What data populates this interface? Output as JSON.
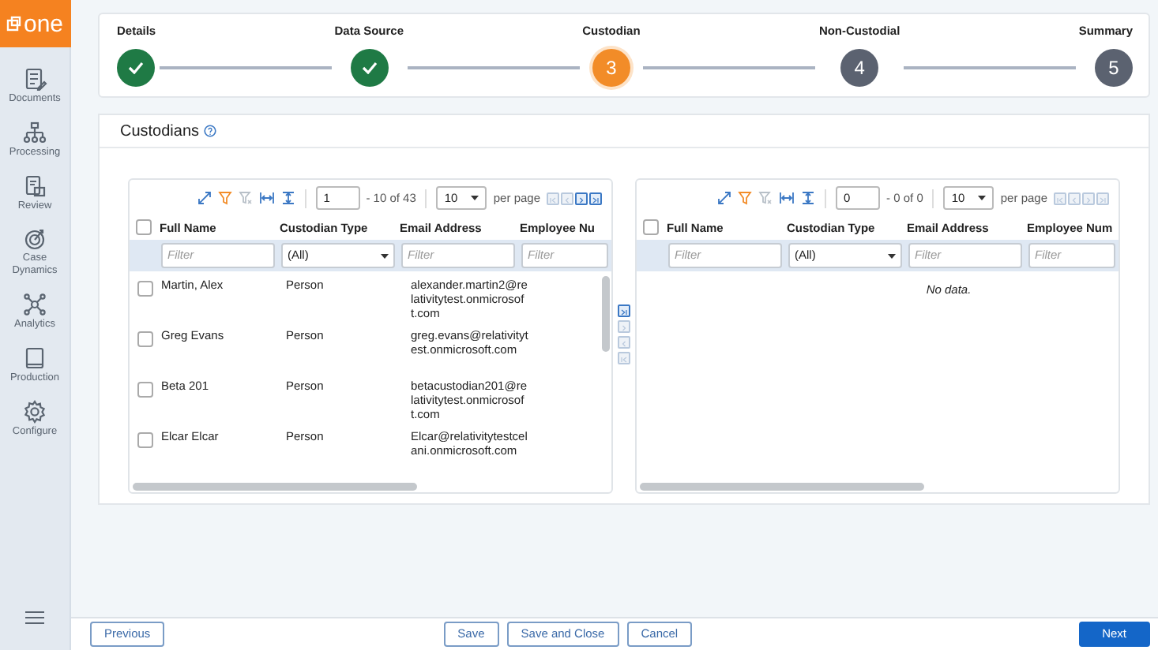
{
  "logo": {
    "text": "one"
  },
  "sidebar": {
    "items": [
      {
        "label": "Documents"
      },
      {
        "label": "Processing"
      },
      {
        "label": "Review"
      },
      {
        "label": "Case Dynamics"
      },
      {
        "label": "Analytics"
      },
      {
        "label": "Production"
      },
      {
        "label": "Configure"
      }
    ]
  },
  "stepper": {
    "steps": [
      {
        "label": "Details",
        "completed": true,
        "selected": false
      },
      {
        "label": "Data Source",
        "completed": true,
        "selected": false
      },
      {
        "label": "Custodian",
        "number": "3",
        "completed": false,
        "selected": true
      },
      {
        "label": "Non-Custodial",
        "number": "4",
        "completed": false,
        "selected": false
      },
      {
        "label": "Summary",
        "number": "5",
        "completed": false,
        "selected": false
      }
    ]
  },
  "section": {
    "title": "Custodians"
  },
  "grids": [
    {
      "all_checked": false,
      "page": "1",
      "range": "- 10 of 43",
      "page_size": "10",
      "per_page_label": "per page",
      "pager": [
        {
          "kind": "first",
          "disabled": true
        },
        {
          "kind": "prev",
          "disabled": true
        },
        {
          "kind": "next",
          "disabled": false
        },
        {
          "kind": "last",
          "disabled": false
        }
      ],
      "columns": [
        "Full Name",
        "Custodian Type",
        "Email Address",
        "Employee Nu"
      ],
      "filters": [
        {
          "kind": "text",
          "placeholder": "Filter"
        },
        {
          "kind": "select",
          "value": "(All)"
        },
        {
          "kind": "text",
          "placeholder": "Filter"
        },
        {
          "kind": "text",
          "placeholder": "Filter"
        }
      ],
      "rows": [
        {
          "checked": false,
          "cells": [
            "Martin, Alex",
            "Person",
            "alexander.martin2@relativitytest.onmicrosoft.com"
          ]
        },
        {
          "checked": false,
          "cells": [
            "Greg Evans",
            "Person",
            "greg.evans@relativitytest.onmicrosoft.com"
          ]
        },
        {
          "checked": false,
          "cells": [
            "Beta 201",
            "Person",
            "betacustodian201@relativitytest.onmicrosoft.com"
          ]
        },
        {
          "checked": false,
          "cells": [
            "Elcar Elcar",
            "Person",
            "Elcar@relativitytestcelani.onmicrosoft.com"
          ]
        }
      ]
    },
    {
      "all_checked": false,
      "page": "0",
      "range": "- 0 of 0",
      "page_size": "10",
      "per_page_label": "per page",
      "pager": [
        {
          "kind": "first",
          "disabled": true
        },
        {
          "kind": "prev",
          "disabled": true
        },
        {
          "kind": "next",
          "disabled": true
        },
        {
          "kind": "last",
          "disabled": true
        }
      ],
      "columns": [
        "Full Name",
        "Custodian Type",
        "Email Address",
        "Employee Num"
      ],
      "filters": [
        {
          "kind": "text",
          "placeholder": "Filter"
        },
        {
          "kind": "select",
          "value": "(All)"
        },
        {
          "kind": "text",
          "placeholder": "Filter"
        },
        {
          "kind": "text",
          "placeholder": "Filter"
        }
      ],
      "empty_text": "No data."
    }
  ],
  "transfer_buttons": [
    {
      "kind": "all-right",
      "disabled": false
    },
    {
      "kind": "right",
      "disabled": true
    },
    {
      "kind": "left",
      "disabled": true
    },
    {
      "kind": "all-left",
      "disabled": true
    }
  ],
  "footer": {
    "left_buttons": [
      {
        "label": "Previous",
        "kind": "outline"
      }
    ],
    "center_buttons": [
      {
        "label": "Save",
        "kind": "outline"
      },
      {
        "label": "Save and Close",
        "kind": "outline"
      },
      {
        "label": "Cancel",
        "kind": "outline"
      }
    ],
    "right_buttons": [
      {
        "label": "Next",
        "kind": "primary"
      }
    ]
  }
}
